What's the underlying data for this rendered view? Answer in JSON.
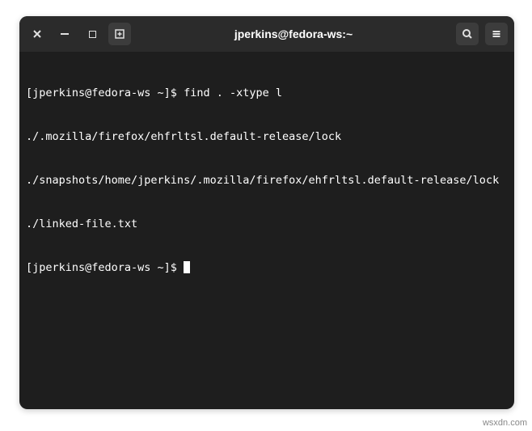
{
  "window": {
    "title": "jperkins@fedora-ws:~"
  },
  "terminal": {
    "prompt1": "[jperkins@fedora-ws ~]$ ",
    "command1": "find . -xtype l",
    "out1": "./.mozilla/firefox/ehfrltsl.default-release/lock",
    "out2": "./snapshots/home/jperkins/.mozilla/firefox/ehfrltsl.default-release/lock",
    "out3": "./linked-file.txt",
    "prompt2": "[jperkins@fedora-ws ~]$ "
  },
  "watermark": "wsxdn.com"
}
